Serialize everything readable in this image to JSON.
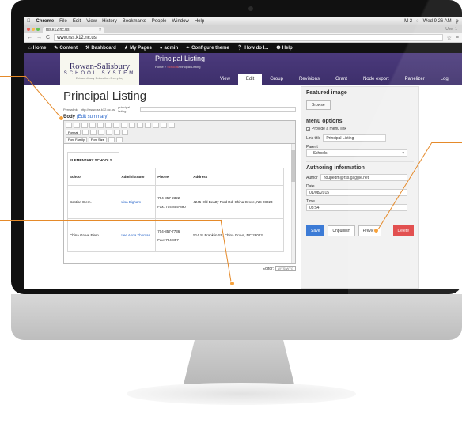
{
  "mac_menubar": {
    "app": "Chrome",
    "items": [
      "File",
      "Edit",
      "View",
      "History",
      "Bookmarks",
      "People",
      "Window",
      "Help"
    ],
    "status_m": "M 2",
    "clock": "Wed 9:26 AM"
  },
  "browser": {
    "tab_title": "rss.k12.nc.us",
    "user": "User 1",
    "url": "www.rss.k12.nc.us"
  },
  "admin_toolbar": {
    "items": [
      "Home",
      "Content",
      "Dashboard",
      "My Pages",
      "admin",
      "Configure theme",
      "How do I...",
      "Help"
    ]
  },
  "site": {
    "logo_line1": "Rowan-Salisbury",
    "logo_line2": "SCHOOL SYSTEM",
    "logo_tagline": "Extraordinary Education Everyday",
    "header_title": "Principal Listing",
    "crumb_home": "Home",
    "crumb_schools": "Schools",
    "crumb_current": "Principal Listing",
    "tabs": [
      "View",
      "Edit",
      "Group",
      "Revisions",
      "Grant",
      "Node export",
      "Panelizer",
      "Log"
    ]
  },
  "form": {
    "page_title": "Principal Listing",
    "permalink_label": "Permalink:",
    "permalink_base": "http://www.rss.k12.nc.us/",
    "permalink_value": "principal-listing",
    "body_label": "Body",
    "edit_summary": "(Edit summary)",
    "format_label": "Format",
    "font_family": "Font Family",
    "font_size": "Font Size",
    "editor_label": "Editor:",
    "editor_value": "WYSIWYG"
  },
  "table": {
    "caption": "ELEMENTARY SCHOOLS",
    "headers": [
      "School",
      "Administrator",
      "Phone",
      "Address"
    ],
    "rows": [
      {
        "school": "Bostian Elem.",
        "admin": "Lisa Bigham",
        "phone": "704-857-2322",
        "fax": "Fax: 704-855-890",
        "address": "4245 Old Beatty Ford Rd. China Grove, NC 28023"
      },
      {
        "school": "China Grove Elem.",
        "admin": "Lee Anna Thomas",
        "phone": "704-857-7736",
        "fax": "Fax: 704-857-",
        "address": "514 S. Franklin St., China Grove, NC 28023"
      }
    ]
  },
  "sidebar": {
    "featured_title": "Featured image",
    "browse": "Browse",
    "menu_title": "Menu options",
    "provide_menu_link": "Provide a menu link",
    "link_title_label": "Link title",
    "link_title_value": "Principal Listing",
    "parent_label": "Parent",
    "parent_value": "-- Schools",
    "authoring_title": "Authoring information",
    "author_label": "Author",
    "author_value": "houpedm@rss.gaggle.net",
    "date_label": "Date",
    "date_value": "01/08/2015",
    "time_label": "Time",
    "time_value": "08:54"
  },
  "actions": {
    "save": "Save",
    "unpublish": "Unpublish",
    "preview": "Preview",
    "delete": "Delete"
  },
  "colors": {
    "accent": "#e58a2a",
    "header": "#4b3a7c",
    "save_blue": "#3c7bd6",
    "delete_red": "#e04141"
  }
}
